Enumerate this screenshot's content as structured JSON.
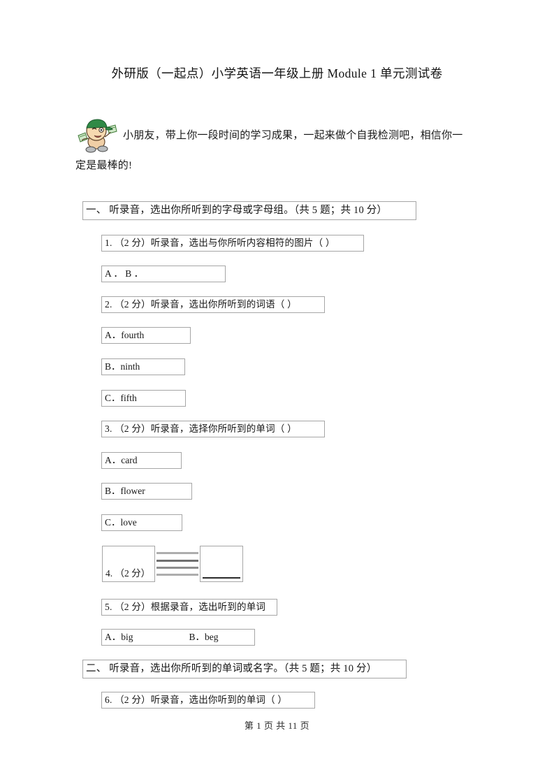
{
  "document": {
    "title": "外研版（一起点）小学英语一年级上册 Module 1 单元测试卷",
    "intro_line1": "小朋友，带上你一段时间的学习成果，一起来做个自我检测吧，相信你一",
    "intro_line2": "定是最棒的!",
    "mascot_alt": "cartoon-boy-with-green-cap",
    "footer": "第 1 页 共 11 页"
  },
  "sections": [
    {
      "id": "section-1",
      "heading": "一、 听录音，选出你所听到的字母或字母组。（共 5 题；共 10 分）",
      "questions": [
        {
          "number": "1.",
          "stem": "1.  （2 分）听录音，选出与你所听内容相符的图片（      ）",
          "options_inline": "A ．                B ．"
        },
        {
          "number": "2.",
          "stem": "2.  （2 分）听录音，选出你所听到的词语（      ）",
          "options": [
            "A．fourth",
            "B．ninth",
            "C．fifth"
          ]
        },
        {
          "number": "3.",
          "stem": "3.  （2 分）听录音，选择你所听到的单词（      ）",
          "options": [
            "A．card",
            "B．flower",
            "C．love"
          ]
        },
        {
          "number": "4.",
          "stem": "4.   （2 分）",
          "image_placeholder": "broken-image"
        },
        {
          "number": "5.",
          "stem": "5.  （2 分）根据录音，选出听到的单词",
          "option_a": "A．big",
          "option_b": "B．beg"
        }
      ]
    },
    {
      "id": "section-2",
      "heading": "二、 听录音，选出你所听到的单词或名字。（共 5 题；共 10 分）",
      "questions": [
        {
          "number": "6.",
          "stem": "6.  （2 分）听录音，选出你听到的单词（      ）"
        }
      ]
    }
  ]
}
